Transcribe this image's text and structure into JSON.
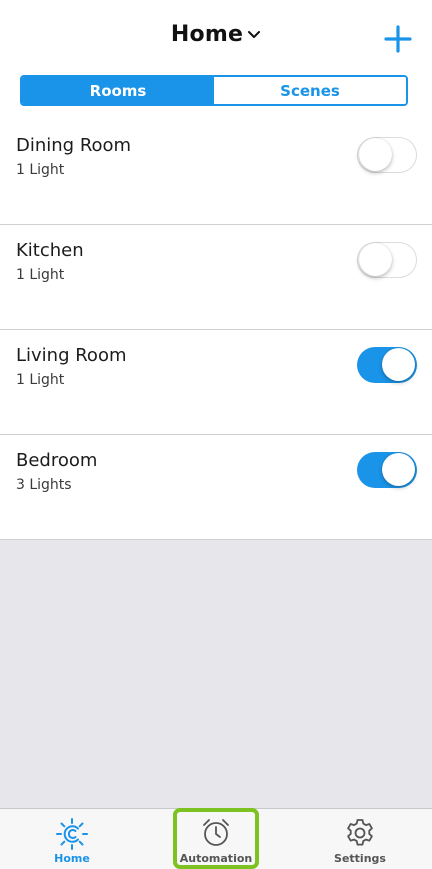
{
  "header": {
    "title": "Home",
    "title_icon": "chevron-down-icon",
    "add_icon": "plus-icon"
  },
  "segments": {
    "rooms_label": "Rooms",
    "scenes_label": "Scenes",
    "selected": "Rooms"
  },
  "rooms": [
    {
      "name": "Dining Room",
      "lights": "1 Light",
      "on": false
    },
    {
      "name": "Kitchen",
      "lights": "1 Light",
      "on": false
    },
    {
      "name": "Living Room",
      "lights": "1 Light",
      "on": true
    },
    {
      "name": "Bedroom",
      "lights": "3 Lights",
      "on": true
    }
  ],
  "tabbar": {
    "home_label": "Home",
    "automation_label": "Automation",
    "settings_label": "Settings",
    "selected": "Home"
  },
  "colors": {
    "accent": "#1a94e8",
    "highlight": "#7cc321",
    "background": "#e7e6ea"
  }
}
